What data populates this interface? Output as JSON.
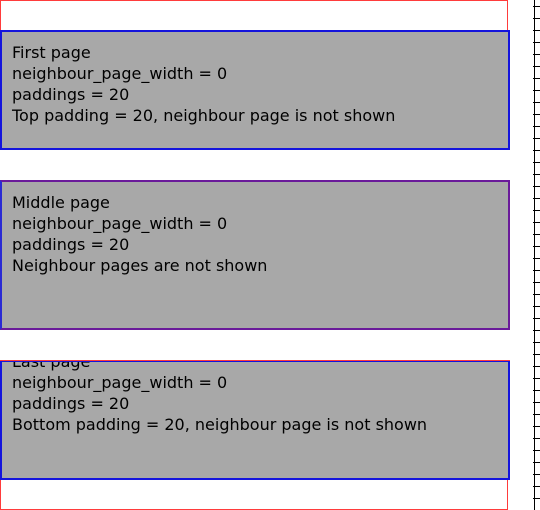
{
  "pages": [
    {
      "title": "First page",
      "width_label": "neighbour_page_width = 0",
      "paddings_label": "paddings = 20",
      "note": "Top padding = 20, neighbour page is not shown"
    },
    {
      "title": "Middle page",
      "width_label": "neighbour_page_width = 0",
      "paddings_label": "paddings = 20",
      "note": "Neighbour pages are not shown"
    },
    {
      "title": "Last page",
      "width_label": "neighbour_page_width = 0",
      "paddings_label": "paddings = 20",
      "note": "Bottom padding = 20, neighbour page is not shown"
    }
  ],
  "colors": {
    "page_frame": "#ff3b3b",
    "card_border": "#1414dc",
    "card_fill": "#a8a8a8"
  }
}
